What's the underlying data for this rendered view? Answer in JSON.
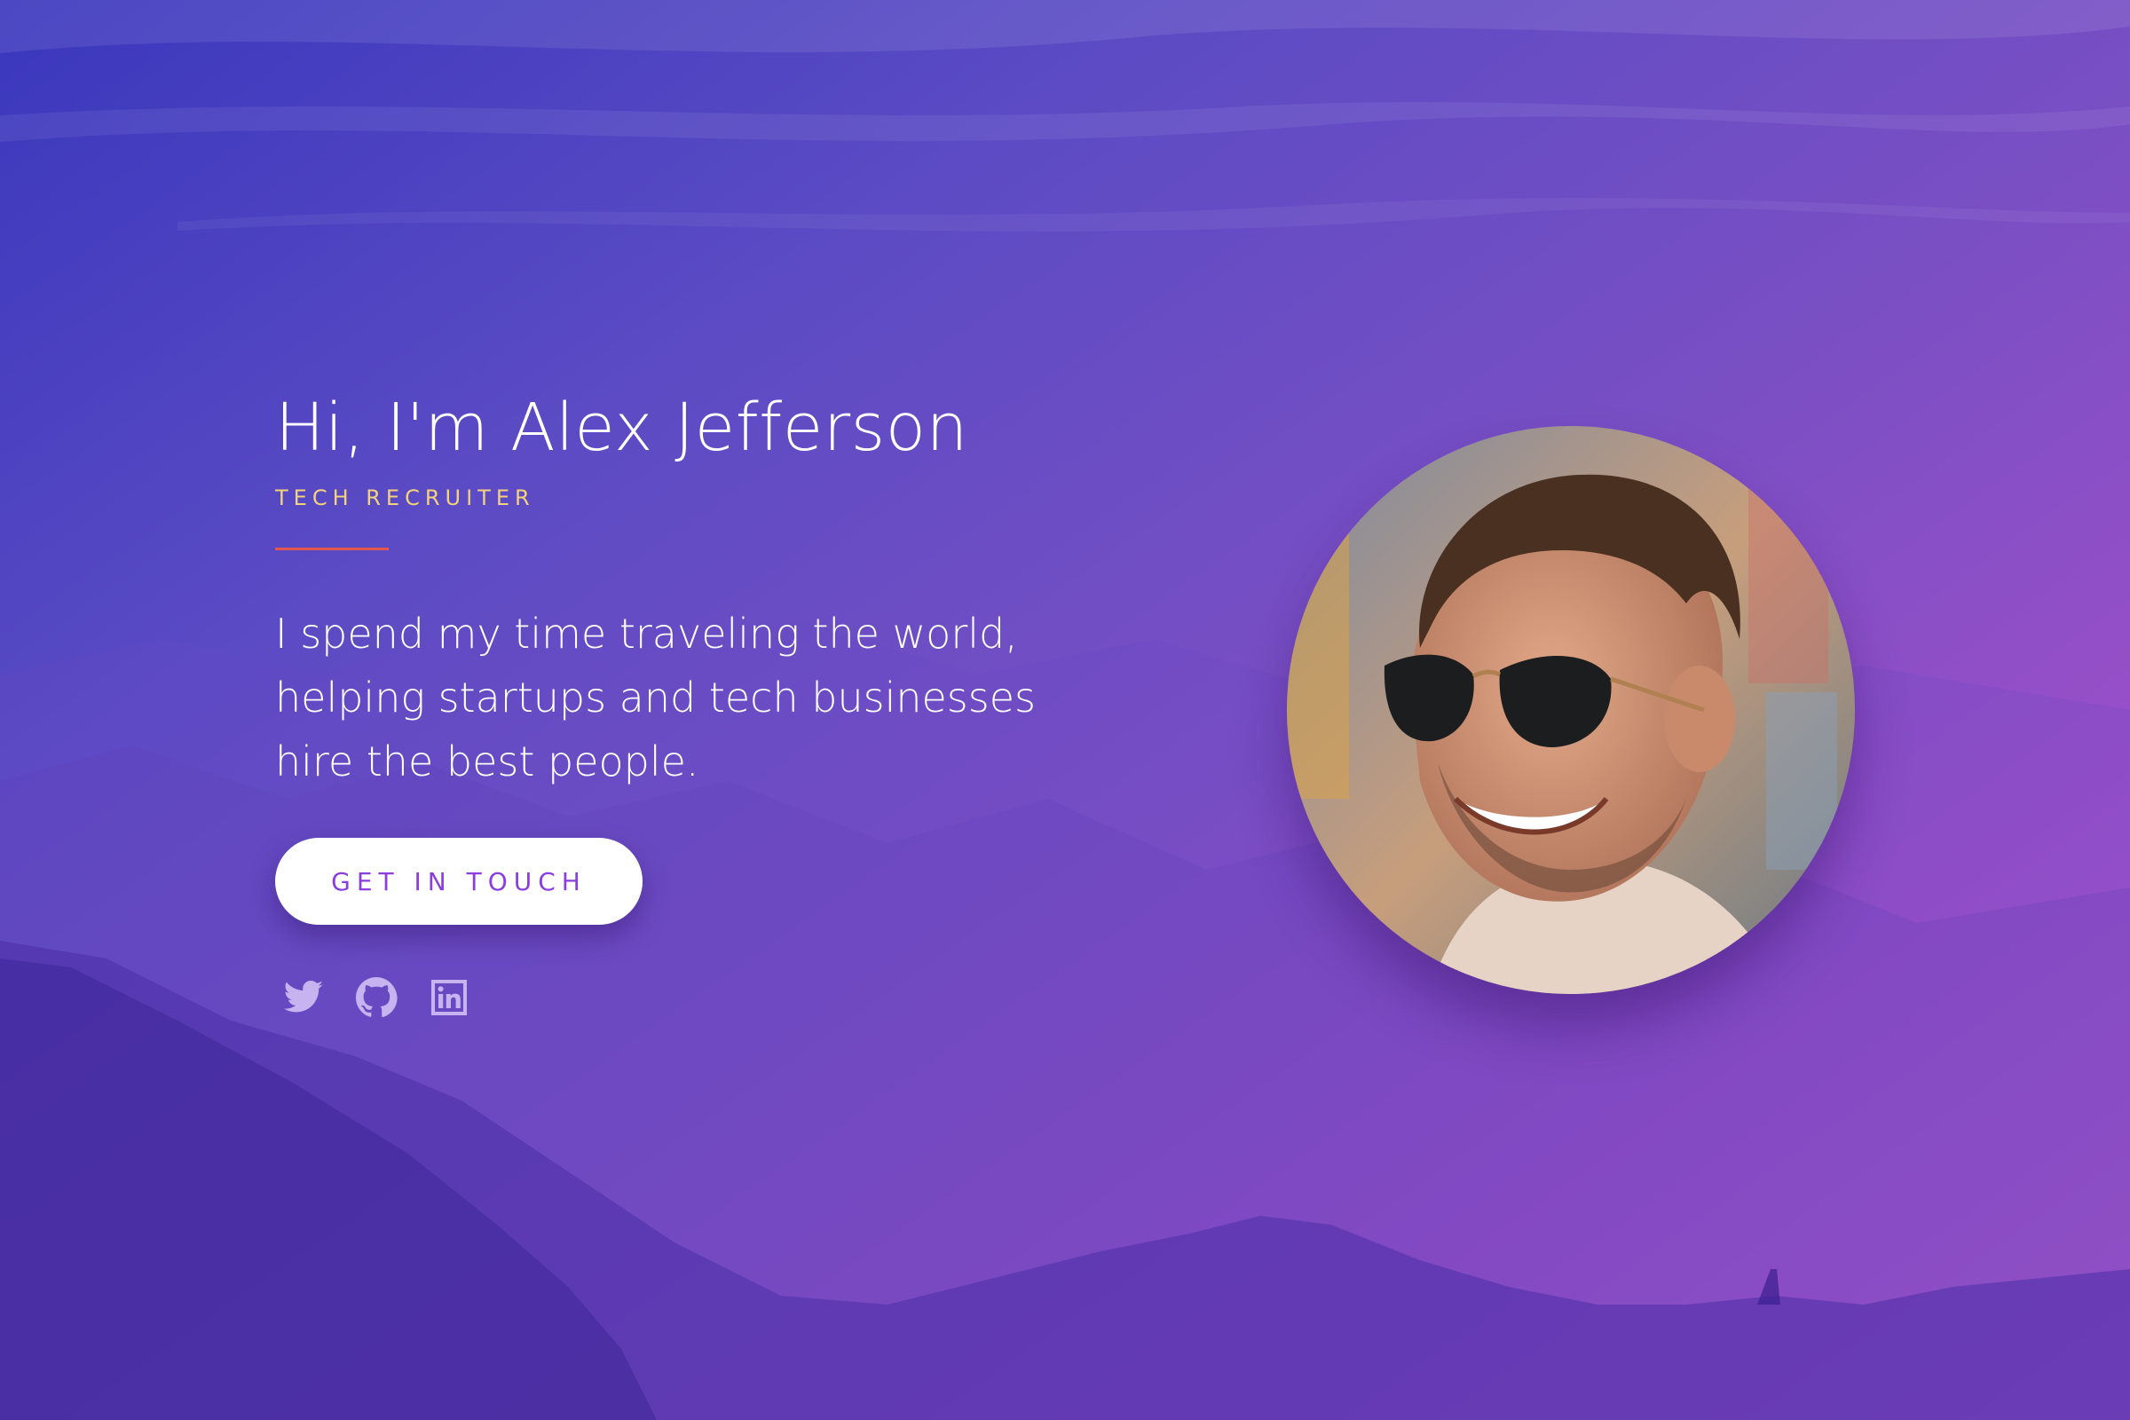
{
  "hero": {
    "name": "Hi, I'm Alex Jefferson",
    "role": "TECH RECRUITER",
    "bio": "I spend my time traveling the world, helping startups and tech businesses hire the best people.",
    "cta_label": "GET IN TOUCH"
  },
  "socials": [
    {
      "name": "twitter-icon"
    },
    {
      "name": "github-icon"
    },
    {
      "name": "linkedin-icon"
    }
  ],
  "colors": {
    "gradient_start": "#3a37bd",
    "gradient_end": "#b45acd",
    "accent_gold": "#f3d27c",
    "divider_red": "#e4574f",
    "button_text": "#8a3ee0"
  }
}
